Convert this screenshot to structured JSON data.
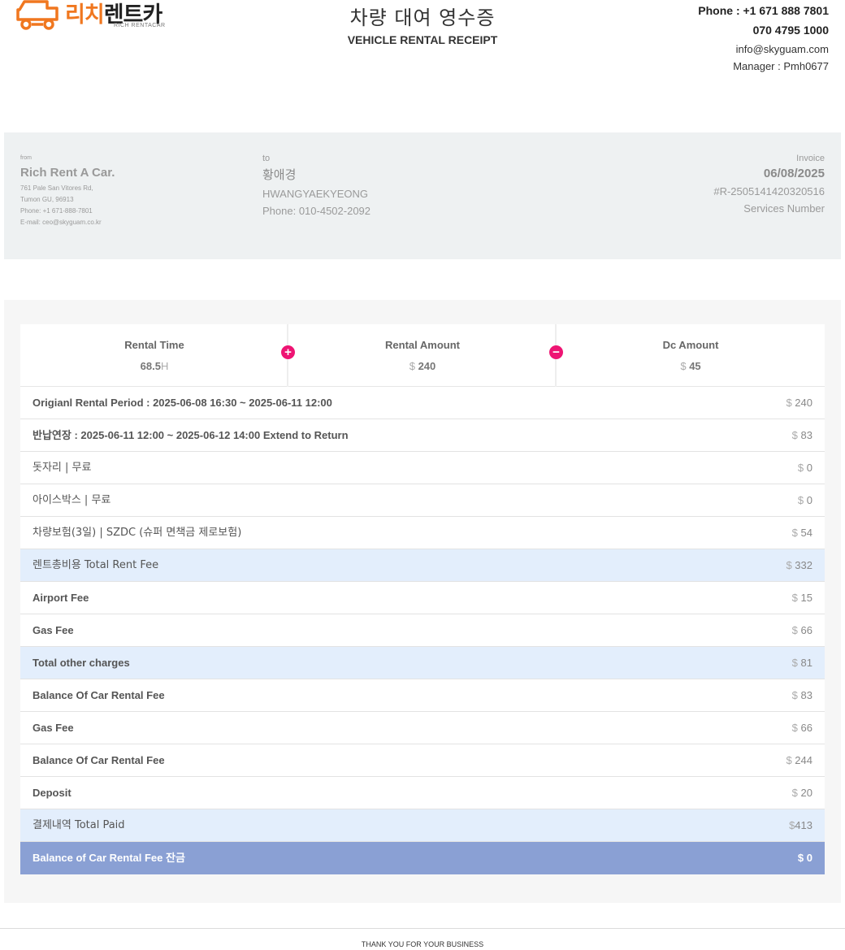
{
  "header": {
    "logo_kr_orange": "리치",
    "logo_kr_dark": "렌트카",
    "logo_en": "RICH RENTACAR",
    "title": "차량 대여 영수증",
    "subtitle": "VEHICLE RENTAL RECEIPT",
    "phone1": "Phone : +1 671 888 7801",
    "phone2": "070 4795 1000",
    "email": "info@skyguam.com",
    "manager": "Manager : Pmh0677"
  },
  "from": {
    "label": "from",
    "name": "Rich Rent A Car.",
    "address1": "761 Pale San Vitores Rd,",
    "address2": "Tumon GU, 96913",
    "phone": "Phone: +1 671-888-7801",
    "email": "E-mail: ceo@skyguam.co.kr"
  },
  "to": {
    "label": "to",
    "name_kr": "황애경",
    "name_en": "HWANGYAEKYEONG",
    "phone": "Phone: 010-4502-2092"
  },
  "invoice": {
    "label": "Invoice",
    "date": "06/08/2025",
    "number": "#R-2505141420320516",
    "caption": "Services Number"
  },
  "summary": {
    "rental_time_label": "Rental Time",
    "rental_time_value": "68.5",
    "rental_time_unit": "H",
    "rental_amount_label": "Rental Amount",
    "rental_amount_currency": "$",
    "rental_amount_value": "240",
    "dc_amount_label": "Dc Amount",
    "dc_amount_currency": "$",
    "dc_amount_value": "45",
    "plus_symbol": "+",
    "minus_symbol": "−"
  },
  "rows": [
    {
      "label": "Origianl Rental Period : 2025-06-08 16:30 ~ 2025-06-11 12:00",
      "currency": "$",
      "value": "240"
    },
    {
      "label": "반납연장 : 2025-06-11 12:00 ~ 2025-06-12 14:00 Extend to Return",
      "currency": "$",
      "value": "83"
    },
    {
      "label": "돗자리 | 무료",
      "currency": "$",
      "value": "0"
    },
    {
      "label": "아이스박스 | 무료",
      "currency": "$",
      "value": "0"
    },
    {
      "label": "차량보험(3일) | SZDC (슈퍼 면책금 제로보험)",
      "currency": "$",
      "value": "54"
    },
    {
      "label": "렌트총비용 Total Rent Fee",
      "currency": "$",
      "value": "332"
    },
    {
      "label": "Airport Fee",
      "currency": "$",
      "value": "15"
    },
    {
      "label": "Gas Fee",
      "currency": "$",
      "value": "66"
    },
    {
      "label": "Total other charges",
      "currency": "$",
      "value": "81"
    },
    {
      "label": "Balance Of Car Rental Fee",
      "currency": "$",
      "value": "83"
    },
    {
      "label": "Gas Fee",
      "currency": "$",
      "value": "66"
    },
    {
      "label": "Balance Of Car Rental Fee",
      "currency": "$",
      "value": "244"
    },
    {
      "label": "Deposit",
      "currency": "$",
      "value": "20"
    },
    {
      "label": "결제내역 Total Paid",
      "currency": "$",
      "value": "413"
    },
    {
      "label": "Balance of Car Rental Fee 잔금",
      "currency": "$",
      "value": "0"
    }
  ],
  "footer": "THANK YOU FOR YOUR BUSINESS",
  "colors": {
    "brand_orange": "#f0771f",
    "sign_pink": "#ee1473",
    "highlight_row": "#e3eefc",
    "final_row": "#8aa0d4",
    "parties_bg": "#eef1f2"
  }
}
